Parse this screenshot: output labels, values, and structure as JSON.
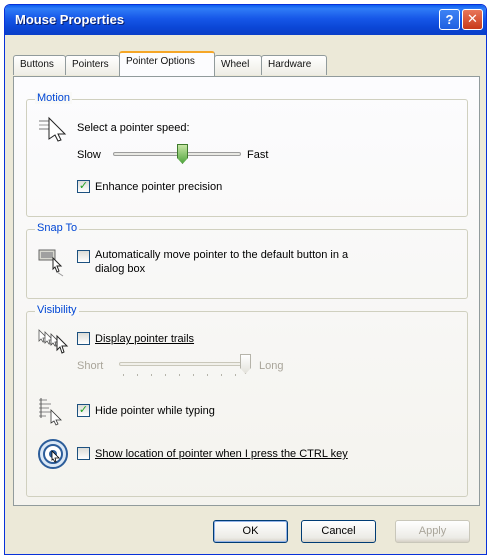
{
  "window": {
    "title": "Mouse Properties",
    "help_glyph": "?",
    "close_glyph": "✕"
  },
  "tabs": [
    {
      "label": "Buttons"
    },
    {
      "label": "Pointers"
    },
    {
      "label": "Pointer Options"
    },
    {
      "label": "Wheel"
    },
    {
      "label": "Hardware"
    }
  ],
  "active_tab": "Pointer Options",
  "motion": {
    "title": "Motion",
    "prompt": "Select a pointer speed:",
    "slow_label": "Slow",
    "fast_label": "Fast",
    "speed_level": 0.55,
    "precision": {
      "label": "Enhance pointer precision",
      "checked": true,
      "mark": "✓"
    }
  },
  "snap_to": {
    "title": "Snap To",
    "label_line1": "Automatically move pointer to the default button in a",
    "label_line2": "dialog box",
    "checked": false
  },
  "visibility": {
    "title": "Visibility",
    "trails": {
      "label": "Display pointer trails",
      "checked": false
    },
    "short_label": "Short",
    "long_label": "Long",
    "trail_level": 1.0,
    "hide_typing": {
      "label": "Hide pointer while typing",
      "checked": true,
      "mark": "✓"
    },
    "show_location": {
      "label": "Show location of pointer when I press the CTRL key",
      "checked": false
    }
  },
  "buttons": {
    "ok": "OK",
    "cancel": "Cancel",
    "apply": "Apply"
  },
  "colors": {
    "title_bar": "#0a4fdc",
    "group_title": "#0046d5",
    "active_tab_top": "#f5a627",
    "check_mark": "#21a121"
  }
}
